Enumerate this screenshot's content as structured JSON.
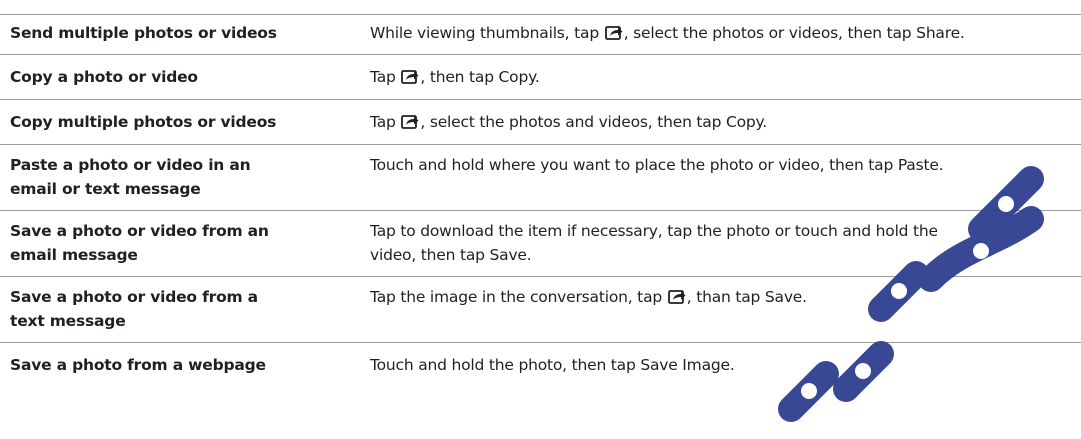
{
  "rows": [
    {
      "action": "Send multiple photos or videos",
      "desc_before": "While viewing thumbnails, tap ",
      "icon": "share-icon",
      "desc_after": ", select the photos or videos, then tap Share."
    },
    {
      "action": "Copy a photo or video",
      "desc_before": "Tap ",
      "icon": "share-icon",
      "desc_after": ", then tap Copy."
    },
    {
      "action": "Copy multiple photos or videos",
      "desc_before": "Tap ",
      "icon": "share-icon",
      "desc_after": ", select the photos and videos, then tap Copy."
    },
    {
      "action_line1": "Paste a photo or video in an",
      "action_line2": "email or text message",
      "desc": "Touch and hold where you want to place the photo or video, then tap Paste."
    },
    {
      "action_line1": "Save a photo or video from an",
      "action_line2": "email message",
      "desc_line1": "Tap to download the item if necessary, tap the photo or touch and hold the",
      "desc_line2": "video, then tap Save."
    },
    {
      "action_line1": "Save a photo or video from a",
      "action_line2": "text message",
      "desc_before": "Tap the image in the conversation, tap ",
      "icon": "share-icon",
      "desc_after": ", than tap Save."
    },
    {
      "action": "Save a photo from a webpage",
      "desc": "Touch and hold the photo, then tap Save Image."
    }
  ],
  "colors": {
    "text": "#231f20",
    "rule": "#9a9a9a",
    "watermark": "#2f3f8f"
  }
}
